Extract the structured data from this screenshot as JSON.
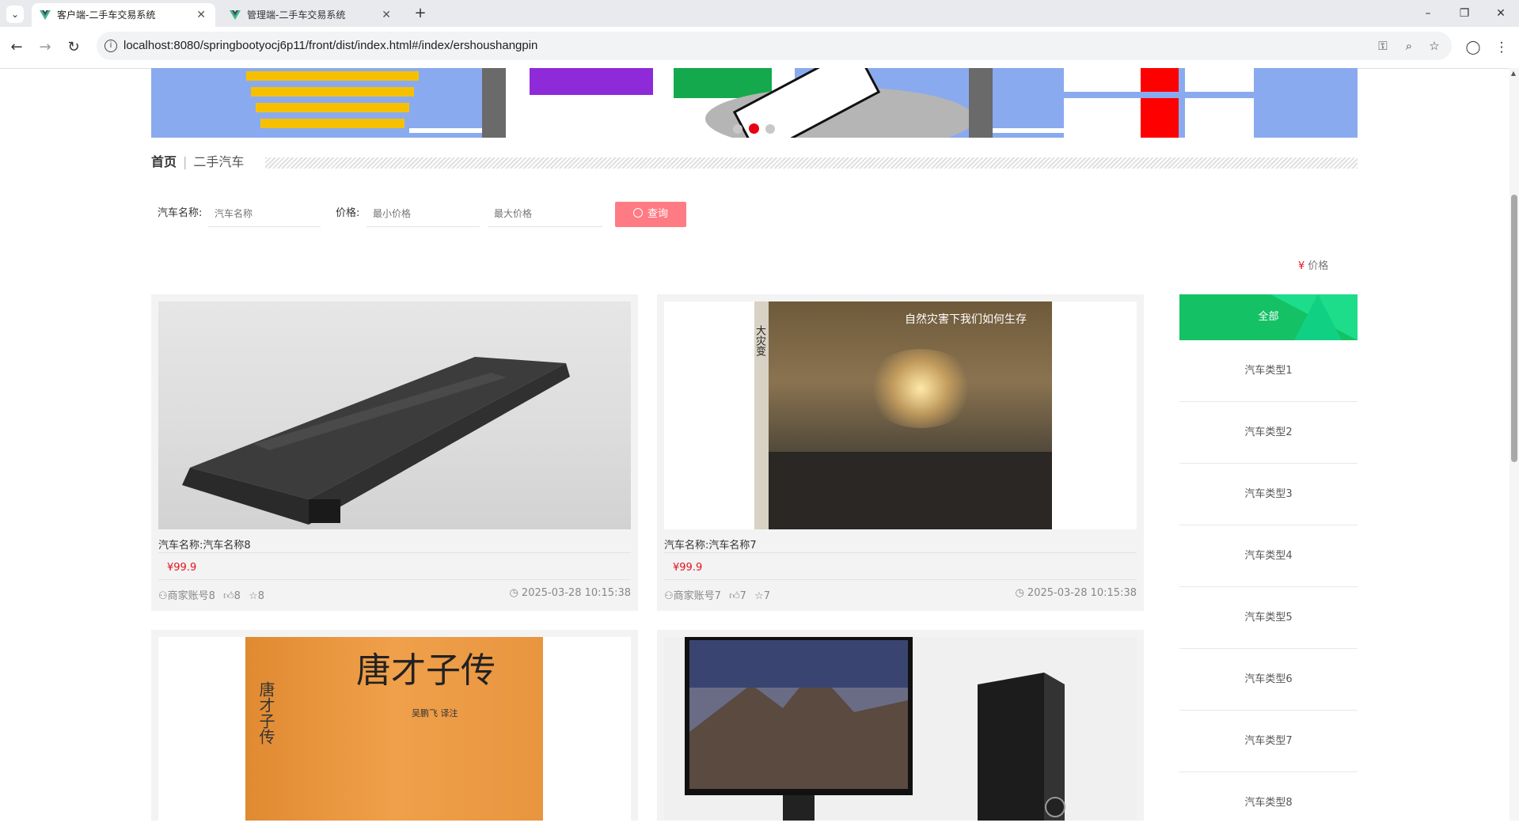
{
  "browser": {
    "tabs": [
      {
        "title": "客户端-二手车交易系统",
        "active": true
      },
      {
        "title": "管理端-二手车交易系统",
        "active": false
      }
    ],
    "url": "localhost:8080/springbootyocj6p11/front/dist/index.html#/index/ershoushangpin"
  },
  "breadcrumb": {
    "home": "首页",
    "separator": "|",
    "current": "二手汽车"
  },
  "search": {
    "name_label": "汽车名称:",
    "name_placeholder": "汽车名称",
    "price_label": "价格:",
    "min_placeholder": "最小价格",
    "max_placeholder": "最大价格",
    "button_label": "查询"
  },
  "sort": {
    "symbol": "¥",
    "label": "价格"
  },
  "cards": [
    {
      "title": "汽车名称:汽车名称8",
      "price": "¥99.9",
      "merchant": "商家账号8",
      "likes": "8",
      "favorites": "8",
      "time": "2025-03-28 10:15:38",
      "image": "laptop"
    },
    {
      "title": "汽车名称:汽车名称7",
      "price": "¥99.9",
      "merchant": "商家账号7",
      "likes": "7",
      "favorites": "7",
      "time": "2025-03-28 10:15:38",
      "image": "book-cover-disaster"
    },
    {
      "image": "book-cover-tang-caizi",
      "book_title": "唐才子传",
      "book_author": "吴鹏飞 译注"
    },
    {
      "image": "desktop-computer"
    }
  ],
  "book_cover_1": {
    "title": "自然灾害下我们如何生存",
    "spine": "大灾变"
  },
  "sidebar": {
    "all_label": "全部",
    "items": [
      "汽车类型1",
      "汽车类型2",
      "汽车类型3",
      "汽车类型4",
      "汽车类型5",
      "汽车类型6",
      "汽车类型7",
      "汽车类型8"
    ]
  },
  "colors": {
    "accent_red": "#e5121b",
    "search_button": "#ff7b84",
    "sidebar_green": "#14c265"
  }
}
